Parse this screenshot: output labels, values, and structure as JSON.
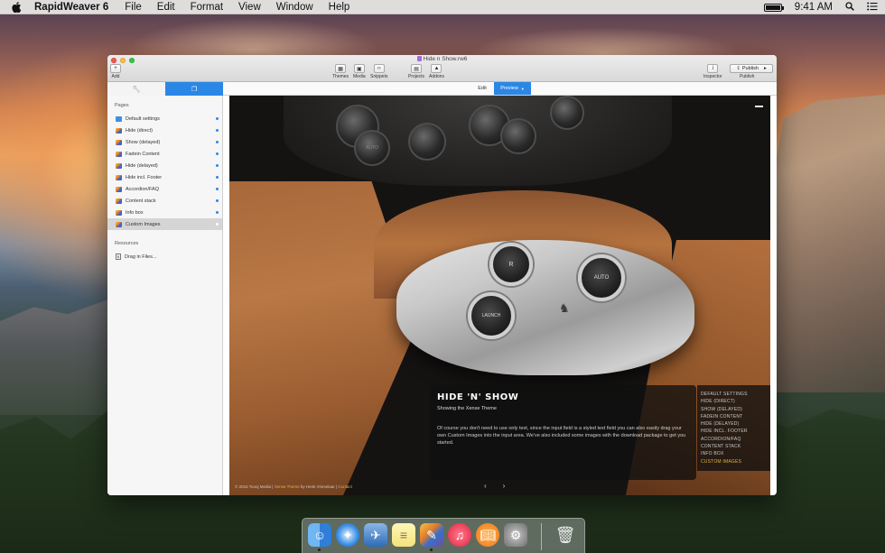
{
  "menubar": {
    "app_name": "RapidWeaver 6",
    "items": [
      "File",
      "Edit",
      "Format",
      "View",
      "Window",
      "Help"
    ],
    "time": "9:41 AM",
    "battery_level": 1.0,
    "icons": [
      "apple-icon",
      "battery-icon",
      "spotlight-icon",
      "notification-center-icon"
    ]
  },
  "window": {
    "title": "Hide n Show.rw6",
    "toolbar": {
      "add": "Add",
      "themes": "Themes",
      "media": "Media",
      "snippets": "Snippets",
      "projects": "Projects",
      "addons": "Addons",
      "inspector": "Inspector",
      "publish_button": "Publish",
      "publish_label": "Publish"
    },
    "view_tabs": {
      "edit": "Edit",
      "preview": "Preview"
    }
  },
  "sidebar": {
    "pages_title": "Pages",
    "pages": [
      {
        "label": "Default settings",
        "icon": "settings-icon"
      },
      {
        "label": "Hide (direct)",
        "icon": "page-icon"
      },
      {
        "label": "Show (delayed)",
        "icon": "page-icon"
      },
      {
        "label": "Fadein Content",
        "icon": "page-icon"
      },
      {
        "label": "Hide (delayed)",
        "icon": "page-icon"
      },
      {
        "label": "Hide incl. Footer",
        "icon": "page-icon"
      },
      {
        "label": "Accordion/FAQ",
        "icon": "page-icon"
      },
      {
        "label": "Content stack",
        "icon": "page-icon"
      },
      {
        "label": "Info box",
        "icon": "page-icon"
      },
      {
        "label": "Custom Images",
        "icon": "page-icon",
        "selected": true
      }
    ],
    "resources_title": "Resources",
    "resources_drop": "Drag in Files..."
  },
  "preview": {
    "buttons": [
      "R",
      "AUTO",
      "LAUNCH"
    ],
    "caption_title": "HIDE 'N' SHOW",
    "caption_subtitle": "Showing the Xense Theme",
    "caption_body": "Of course you don't need to use only text, since the input field is a styled text field you can also easily drag your own Custom Images into the input area. We've also included some images with the download package to get you started.",
    "menu": [
      "DEFAULT SETTINGS",
      "HIDE (DIRECT)",
      "SHOW (DELAYED)",
      "FADEIN CONTENT",
      "HIDE (DELAYED)",
      "HIDE INCL. FOOTER",
      "ACCORDION/FAQ",
      "CONTENT STACK",
      "INFO BOX",
      "CUSTOM IMAGES"
    ],
    "footer_prefix": "© 2015 Toooj Media | ",
    "footer_theme": "Xense Theme",
    "footer_by": " by Henk Vrieselaar | ",
    "footer_contact": "Contact",
    "accent_color": "#e0b341"
  },
  "dock": {
    "apps": [
      "finder-icon",
      "safari-icon",
      "mail-icon",
      "notes-icon",
      "rapidweaver-icon",
      "itunes-icon",
      "ibooks-icon",
      "system-preferences-icon",
      "trash-icon"
    ]
  }
}
